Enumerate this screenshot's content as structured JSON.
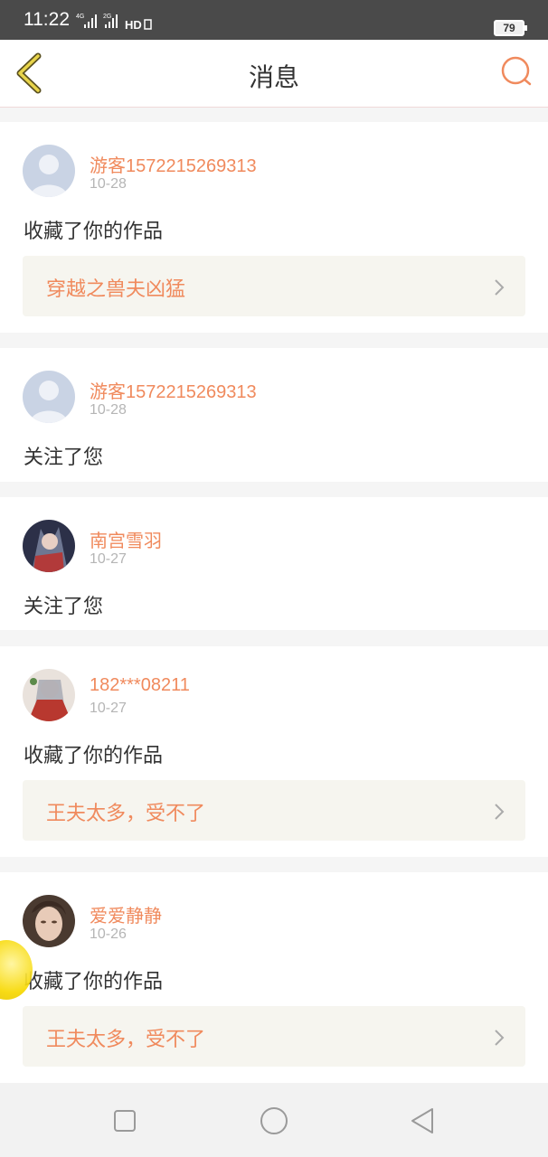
{
  "status_bar": {
    "time": "11:22",
    "battery": "79"
  },
  "header": {
    "title": "消息"
  },
  "messages": [
    {
      "user": "游客1572215269313",
      "date": "10-28",
      "action": "收藏了你的作品",
      "work": "穿越之兽夫凶猛",
      "avatar": "default-avatar-icon"
    },
    {
      "user": "游客1572215269313",
      "date": "10-28",
      "action": "关注了您",
      "avatar": "default-avatar-icon"
    },
    {
      "user": "南宫雪羽",
      "date": "10-27",
      "action": "关注了您",
      "avatar": "anime-avatar-image"
    },
    {
      "user": "182***08211",
      "date": "10-27",
      "action": "收藏了你的作品",
      "work": "王夫太多，受不了",
      "avatar": "anime-avatar-image"
    },
    {
      "user": "爱爱静静",
      "date": "10-26",
      "action": "收藏了你的作品",
      "work": "王夫太多，受不了",
      "avatar": "photo-avatar-image"
    }
  ],
  "colors": {
    "accent": "#f08a5d",
    "back_icon": "#c9b035",
    "date": "#b5b5b5",
    "work_bg": "#f6f5ef"
  }
}
